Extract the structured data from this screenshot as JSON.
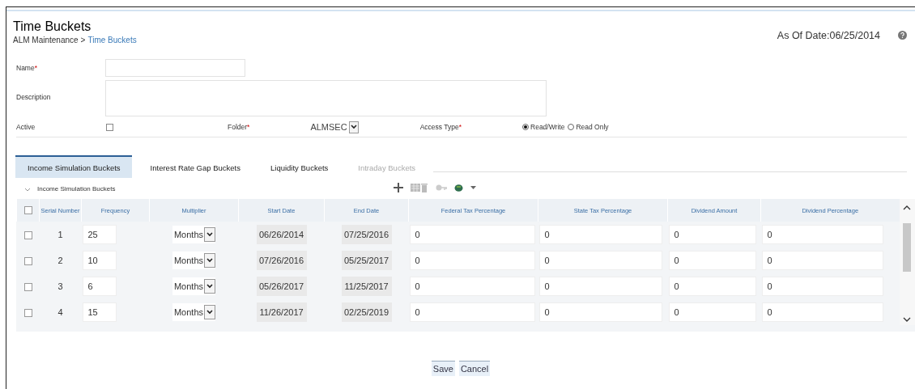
{
  "title": "Time Buckets",
  "breadcrumb": {
    "parent": "ALM Maintenance",
    "separator": ">",
    "current": "Time Buckets"
  },
  "as_of_date": "As Of Date:06/25/2014",
  "form": {
    "name": {
      "label": "Name",
      "required_mark": "*"
    },
    "description": {
      "label": "Description"
    },
    "active": {
      "label": "Active",
      "checked": false
    },
    "folder": {
      "label": "Folder",
      "required_mark": "*",
      "value": "ALMSEC"
    },
    "access_type": {
      "label": "Access Type",
      "required_mark": "*",
      "options": [
        {
          "label": "Read/Write",
          "selected": true
        },
        {
          "label": "Read Only",
          "selected": false
        }
      ]
    }
  },
  "tabs": [
    {
      "label": "Income Simulation Buckets",
      "selected": true,
      "disabled": false
    },
    {
      "label": "Interest Rate Gap Buckets",
      "selected": false,
      "disabled": false
    },
    {
      "label": "Liquidity Buckets",
      "selected": false,
      "disabled": false
    },
    {
      "label": "Intraday Buckets",
      "selected": false,
      "disabled": true
    }
  ],
  "section": {
    "title": "Income Simulation Buckets",
    "expanded": true
  },
  "table": {
    "select_all_checked": false,
    "columns": [
      "Serial Number",
      "Frequency",
      "Multiplier",
      "Start Date",
      "End Date",
      "Federal Tax Percentage",
      "State Tax Percentage",
      "Dividend Amount",
      "Dividend Percentage"
    ],
    "rows": [
      {
        "checked": false,
        "cells": [
          "1",
          "25",
          "Months",
          "06/26/2014",
          "07/25/2016",
          "0",
          "0",
          "0",
          "0"
        ]
      },
      {
        "checked": false,
        "cells": [
          "2",
          "10",
          "Months",
          "07/26/2016",
          "05/25/2017",
          "0",
          "0",
          "0",
          "0"
        ]
      },
      {
        "checked": false,
        "cells": [
          "3",
          "6",
          "Months",
          "05/26/2017",
          "11/25/2017",
          "0",
          "0",
          "0",
          "0"
        ]
      },
      {
        "checked": false,
        "cells": [
          "4",
          "15",
          "Months",
          "11/26/2017",
          "02/25/2019",
          "0",
          "0",
          "0",
          "0"
        ]
      }
    ]
  },
  "buttons": [
    "Save",
    "Cancel"
  ]
}
